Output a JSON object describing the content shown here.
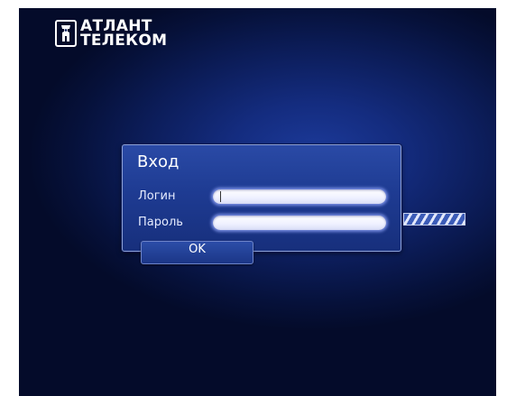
{
  "logo": {
    "line1": "АТЛАНТ",
    "line2": "ТЕЛЕКОМ",
    "icon": "atlas-figure-icon"
  },
  "login_dialog": {
    "title": "Вход",
    "login_label": "Логин",
    "login_value": "",
    "password_label": "Пароль",
    "password_value": "",
    "ok_label": "OK"
  },
  "colors": {
    "background_center": "#1c3a9a",
    "background_edge": "#040b2a",
    "dialog": "#1e3b92",
    "input": "#eef0ff",
    "text": "#ffffff"
  }
}
